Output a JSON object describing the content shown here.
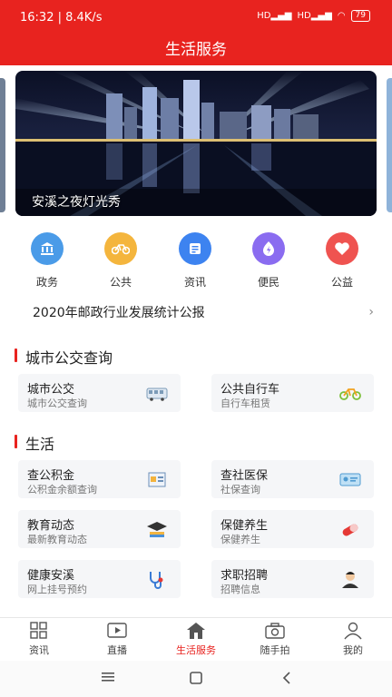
{
  "status": {
    "time_speed": "16:32 | 8.4K/s",
    "net1": "HD",
    "net2": "HD",
    "battery": "79"
  },
  "title": "生活服务",
  "banner": {
    "caption": "安溪之夜灯光秀"
  },
  "quick": [
    {
      "label": "政务",
      "icon": "bank-icon",
      "color": "#4a9be8"
    },
    {
      "label": "公共",
      "icon": "bike-icon",
      "color": "#f4b53d"
    },
    {
      "label": "资讯",
      "icon": "document-icon",
      "color": "#3d83f0"
    },
    {
      "label": "便民",
      "icon": "lightning-icon",
      "color": "#8a6cf0"
    },
    {
      "label": "公益",
      "icon": "heart-icon",
      "color": "#ef5350"
    }
  ],
  "notice": {
    "text": "2020年邮政行业发展统计公报"
  },
  "sections": {
    "bus": {
      "title": "城市公交查询"
    },
    "life": {
      "title": "生活"
    }
  },
  "cards": {
    "bus": {
      "t1": "城市公交",
      "t2": "城市公交查询"
    },
    "bike": {
      "t1": "公共自行车",
      "t2": "自行车租赁"
    },
    "fund": {
      "t1": "查公积金",
      "t2": "公积金余额查询"
    },
    "social": {
      "t1": "查社医保",
      "t2": "社保查询"
    },
    "edu": {
      "t1": "教育动态",
      "t2": "最新教育动态"
    },
    "health": {
      "t1": "保健养生",
      "t2": "保健养生"
    },
    "hospital": {
      "t1": "健康安溪",
      "t2": "网上挂号预约"
    },
    "job": {
      "t1": "求职招聘",
      "t2": "招聘信息"
    }
  },
  "tabs": [
    {
      "label": "资讯",
      "icon": "grid-icon"
    },
    {
      "label": "直播",
      "icon": "play-icon"
    },
    {
      "label": "生活服务",
      "icon": "home-icon",
      "active": true
    },
    {
      "label": "随手拍",
      "icon": "camera-icon"
    },
    {
      "label": "我的",
      "icon": "user-icon"
    }
  ],
  "colors": {
    "brand": "#e8231f"
  }
}
